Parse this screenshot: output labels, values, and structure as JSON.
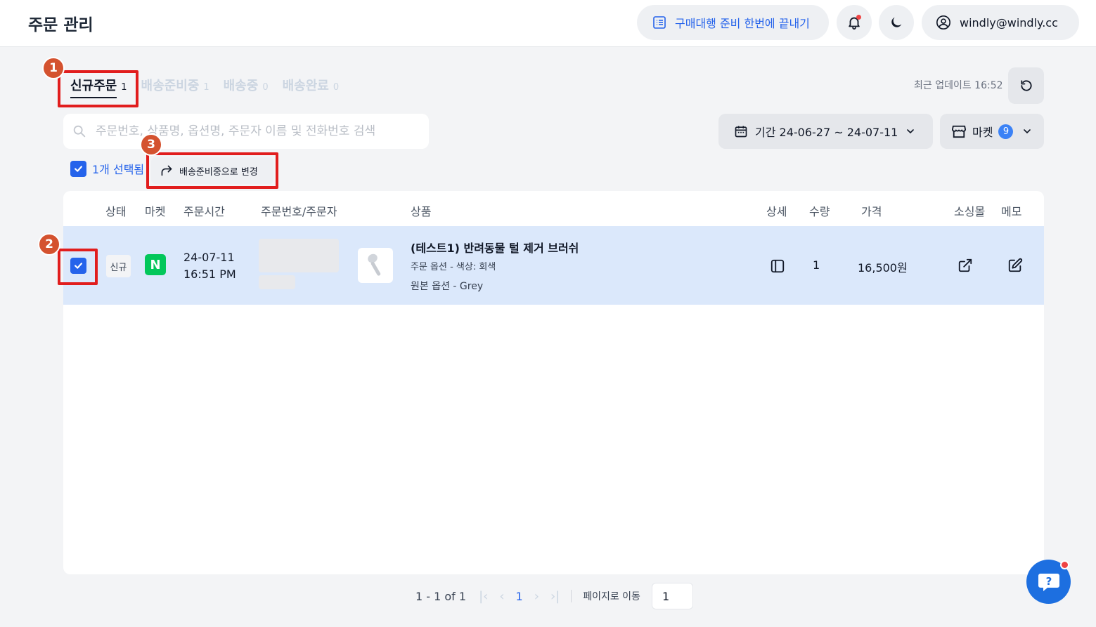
{
  "header": {
    "title": "주문 관리",
    "promo_label": "구매대행 준비 한번에 끝내기",
    "account_email": "windly@windly.cc"
  },
  "tabs": [
    {
      "label": "신규주문",
      "count": "1",
      "active": true
    },
    {
      "label": "배송준비중",
      "count": "1"
    },
    {
      "label": "배송중",
      "count": "0"
    },
    {
      "label": "배송완료",
      "count": "0"
    }
  ],
  "last_update": "최근 업데이트 16:52",
  "search": {
    "placeholder": "주문번호, 상품명, 옵션명, 주문자 이름 및 전화번호 검색",
    "value": ""
  },
  "filters": {
    "period_label": "기간 24-06-27 ~ 24-07-11",
    "market_label": "마켓",
    "market_count": "9"
  },
  "selection": {
    "selected_text": "1개 선택됨",
    "change_button": "배송준비중으로 변경"
  },
  "table": {
    "columns": [
      "상태",
      "마켓",
      "주문시간",
      "주문번호/주문자",
      "상품",
      "상세",
      "수량",
      "가격",
      "소싱몰",
      "메모"
    ],
    "rows": [
      {
        "status": "신규",
        "market_logo": "N",
        "date": "24-07-11",
        "time": "16:51 PM",
        "product_name": "(테스트1) 반려동물 털 제거 브러쉬",
        "order_option": "주문 옵션 - 색상: 회색",
        "original_option": "원본 옵션 - Grey",
        "quantity": "1",
        "price": "16,500원"
      }
    ]
  },
  "pagination": {
    "range": "1 - 1 of 1",
    "current_page": "1",
    "goto_label": "페이지로 이동",
    "goto_value": "1"
  },
  "annotations": [
    "1",
    "2",
    "3"
  ],
  "colors": {
    "accent": "#2563eb",
    "highlight": "#e11d1d",
    "marker": "#d4522f",
    "naver": "#03c75a",
    "row_selected": "#dbe8fb"
  }
}
